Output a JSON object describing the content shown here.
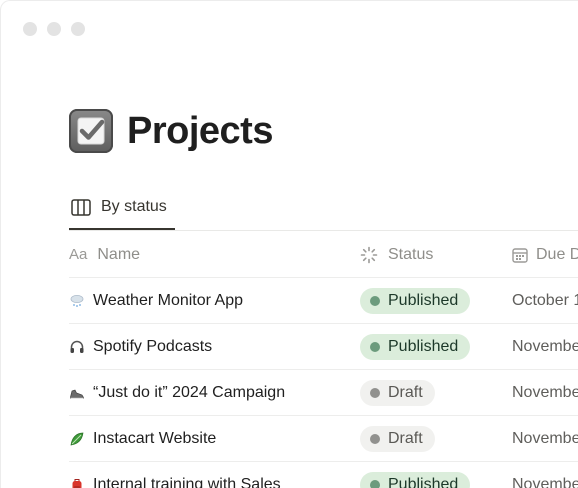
{
  "colors": {
    "published_bg": "#dbeddb",
    "published_dot": "#6c9b7d",
    "published_text": "#1c3829",
    "draft_bg": "#f1f1ef",
    "draft_dot": "#91918e",
    "draft_text": "#5a5955"
  },
  "page": {
    "title": "Projects",
    "title_icon": "checkbox-icon"
  },
  "view": {
    "tab_label": "By status",
    "tab_icon": "board-columns-icon"
  },
  "table": {
    "headers": {
      "name_prefix": "Aa",
      "name": "Name",
      "status": "Status",
      "status_icon": "status-spinner-icon",
      "due": "Due D",
      "due_icon": "calendar-icon"
    },
    "rows": [
      {
        "icon": "cloud-snow-icon",
        "name": "Weather Monitor App",
        "status": "Published",
        "status_kind": "published",
        "due": "October 1"
      },
      {
        "icon": "headphones-icon",
        "name": "Spotify Podcasts",
        "status": "Published",
        "status_kind": "published",
        "due": "Novembe"
      },
      {
        "icon": "sneaker-icon",
        "name": "“Just do it” 2024 Campaign",
        "status": "Draft",
        "status_kind": "draft",
        "due": "Novembe"
      },
      {
        "icon": "leafy-green-icon",
        "name": "Instacart Website",
        "status": "Draft",
        "status_kind": "draft",
        "due": "Novembe"
      },
      {
        "icon": "red-backpack-icon",
        "name": "Internal training with Sales",
        "status": "Published",
        "status_kind": "published",
        "due": "Novembe"
      }
    ]
  }
}
